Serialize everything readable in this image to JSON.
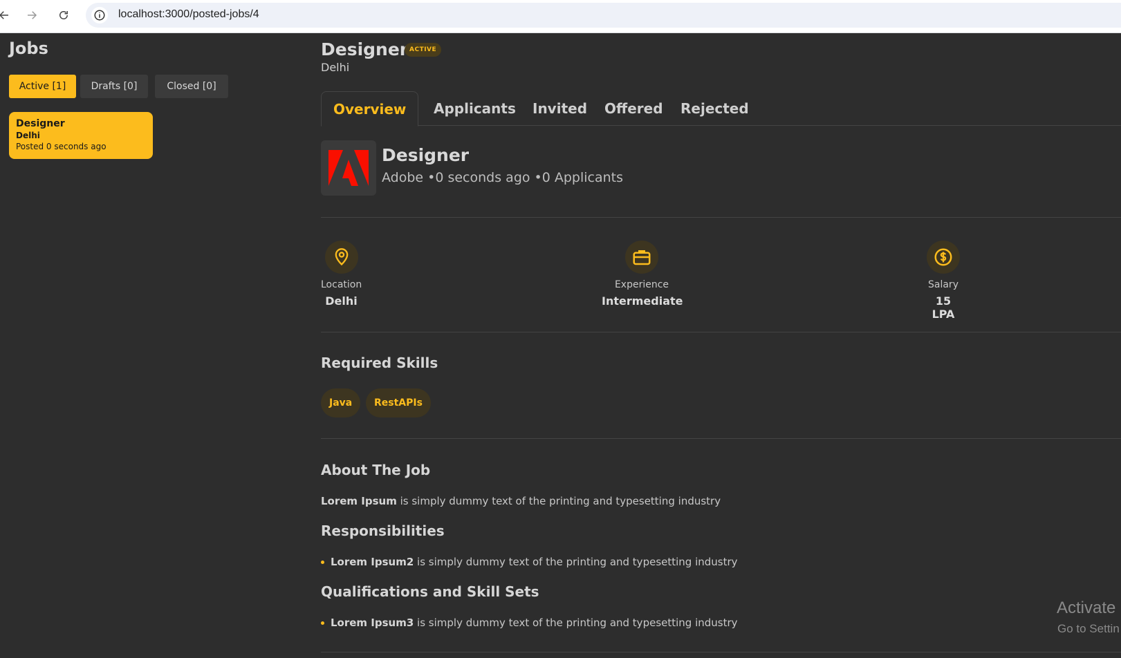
{
  "browser": {
    "url": "localhost:3000/posted-jobs/4"
  },
  "sidebar": {
    "title": "Jobs",
    "filters": [
      {
        "label": "Active [1]"
      },
      {
        "label": "Drafts [0]"
      },
      {
        "label": "Closed [0]"
      }
    ],
    "job_card": {
      "title": "Designer",
      "location": "Delhi",
      "posted": "Posted 0 seconds ago"
    }
  },
  "main": {
    "title": "Designer",
    "status": "ACTIVE",
    "location": "Delhi",
    "tabs": [
      {
        "label": "Overview"
      },
      {
        "label": "Applicants"
      },
      {
        "label": "Invited"
      },
      {
        "label": "Offered"
      },
      {
        "label": "Rejected"
      }
    ],
    "role": {
      "title": "Designer",
      "meta": "Adobe •0 seconds ago •0 Applicants"
    },
    "stats": [
      {
        "label": "Location",
        "value": "Delhi",
        "icon": "map-pin-icon"
      },
      {
        "label": "Experience",
        "value": "Intermediate",
        "icon": "briefcase-icon"
      },
      {
        "label": "Salary",
        "value": "15 LPA",
        "icon": "dollar-circle-icon"
      }
    ],
    "skills_title": "Required Skills",
    "skills": [
      "Java",
      "RestAPIs"
    ],
    "about_title": "About The Job",
    "about": {
      "bold": "Lorem Ipsum",
      "text": " is simply dummy text of the printing and typesetting industry"
    },
    "responsibilities_title": "Responsibilities",
    "responsibilities": [
      {
        "bold": "Lorem Ipsum2",
        "text": " is simply dummy text of the printing and typesetting industry"
      }
    ],
    "qualifications_title": "Qualifications and Skill Sets",
    "qualifications": [
      {
        "bold": "Lorem Ipsum3",
        "text": " is simply dummy text of the printing and typesetting industry"
      }
    ]
  },
  "watermark": {
    "title": "Activate",
    "sub": "Go to Settin"
  },
  "colors": {
    "accent": "#fcbc1d",
    "background": "#2d2d2d",
    "adobe_red": "#fa0f00"
  }
}
